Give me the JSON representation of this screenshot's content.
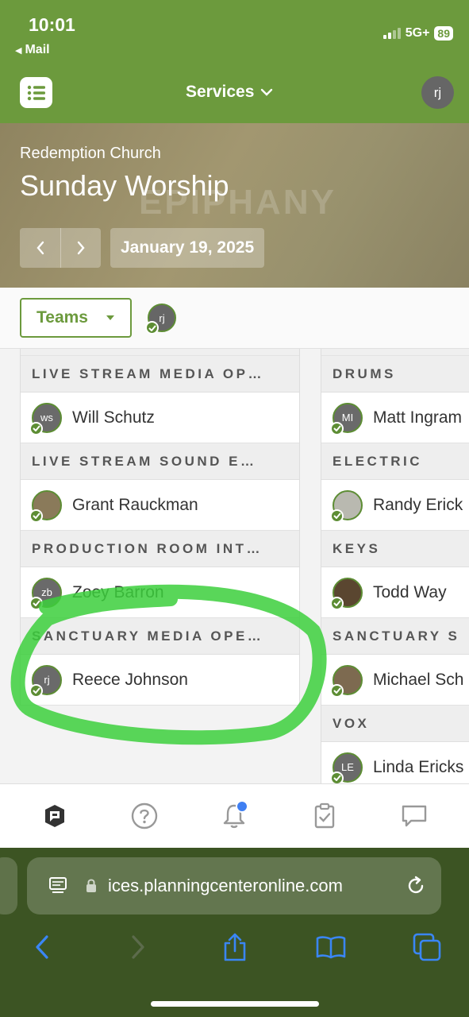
{
  "status_bar": {
    "time": "10:01",
    "back_app": "Mail",
    "network": "5G+",
    "battery": "89"
  },
  "nav": {
    "title": "Services",
    "user_initials": "rj"
  },
  "header": {
    "organization": "Redemption Church",
    "plan_title": "Sunday Worship",
    "date": "January 19, 2025"
  },
  "toolbar": {
    "teams_label": "Teams",
    "viewer_initials": "rj"
  },
  "left_column": [
    {
      "position": "LIVE STREAM MEDIA OP…",
      "person": "Will Schutz",
      "initials": "ws",
      "avatar_color": "#6a6a6a"
    },
    {
      "position": "LIVE STREAM SOUND E…",
      "person": "Grant Rauckman",
      "initials": "",
      "avatar_color": "#8a7a5a"
    },
    {
      "position": "PRODUCTION ROOM INT…",
      "person": "Zoey Barron",
      "initials": "zb",
      "avatar_color": "#6a6a6a"
    },
    {
      "position": "SANCTUARY MEDIA OPE…",
      "person": "Reece Johnson",
      "initials": "rj",
      "avatar_color": "#6a6a6a"
    }
  ],
  "right_column": [
    {
      "position": "DRUMS",
      "person": "Matt Ingram",
      "initials": "MI",
      "avatar_color": "#6a6a6a"
    },
    {
      "position": "ELECTRIC",
      "person": "Randy Erick",
      "initials": "",
      "avatar_color": "#b9b9b0"
    },
    {
      "position": "KEYS",
      "person": "Todd Way",
      "initials": "",
      "avatar_color": "#5a4630"
    },
    {
      "position": "SANCTUARY S",
      "person": "Michael Sch",
      "initials": "",
      "avatar_color": "#7d6a50"
    },
    {
      "position": "VOX",
      "person": "Linda Ericks",
      "initials": "LE",
      "avatar_color": "#6a6a6a"
    }
  ],
  "tabbar": {
    "icons": [
      "planning-center-icon",
      "help-icon",
      "notifications-icon",
      "tasks-icon",
      "chat-icon"
    ]
  },
  "safari": {
    "url": "ices.planningcenteronline.com"
  },
  "colors": {
    "brand_green": "#6c9a3d",
    "annotation_green": "#3ccf3c",
    "badge_blue": "#3f7ff2"
  }
}
